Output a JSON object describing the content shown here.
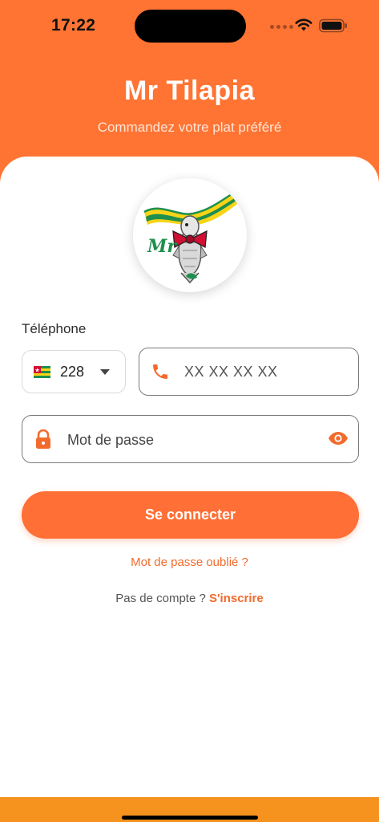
{
  "status_bar": {
    "time": "17:22",
    "icons": [
      "signal-dots-icon",
      "wifi-icon",
      "battery-icon"
    ]
  },
  "header": {
    "title": "Mr Tilapia",
    "subtitle": "Commandez votre plat préféré"
  },
  "logo": {
    "monogram": "Mr",
    "description_icon": "tilapia-fish-logo"
  },
  "form": {
    "phone_label": "Téléphone",
    "country_code": "228",
    "country_flag": "togo-flag-icon",
    "phone_placeholder": "XX XX XX XX",
    "password_placeholder": "Mot de passe"
  },
  "actions": {
    "login_label": "Se connecter",
    "forgot_password": "Mot de passe oublié ?",
    "no_account": "Pas de compte ?",
    "signup": "S'inscrire"
  },
  "colors": {
    "brand_orange": "#ff7433",
    "accent_orange": "#f26b2d",
    "footer_orange": "#f6921e",
    "togo_green": "#1f8f4e",
    "togo_yellow": "#f7d417",
    "togo_red": "#d21034"
  }
}
